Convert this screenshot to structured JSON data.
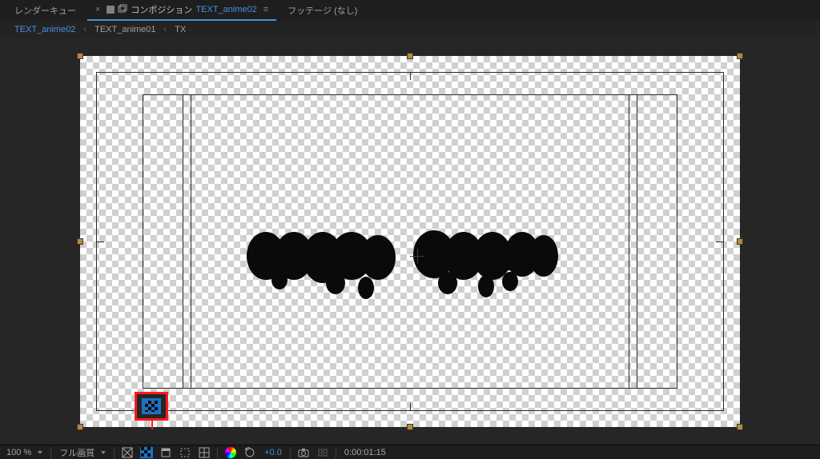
{
  "tabs": {
    "render_queue": "レンダーキュー",
    "comp_prefix": "コンポジション",
    "comp_name": "TEXT_anime02",
    "footage": "フッテージ (なし)"
  },
  "breadcrumb": {
    "items": [
      {
        "label": "TEXT_anime02",
        "primary": true
      },
      {
        "label": "TEXT_anime01",
        "primary": false
      },
      {
        "label": "TX",
        "primary": false
      }
    ]
  },
  "status": {
    "zoom": "100 %",
    "resolution": "フル画質",
    "exposure": "+0.0",
    "timecode": "0:00:01:15"
  },
  "icons": {
    "grid": "grid-icon",
    "transparency": "transparency-grid-icon",
    "mask": "mask-icon",
    "region": "region-icon",
    "guides": "guides-icon",
    "channels": "channels-icon",
    "reset_exposure": "reset-exposure-icon",
    "snapshot": "snapshot-icon",
    "preview_time": "preview-time-icon"
  }
}
